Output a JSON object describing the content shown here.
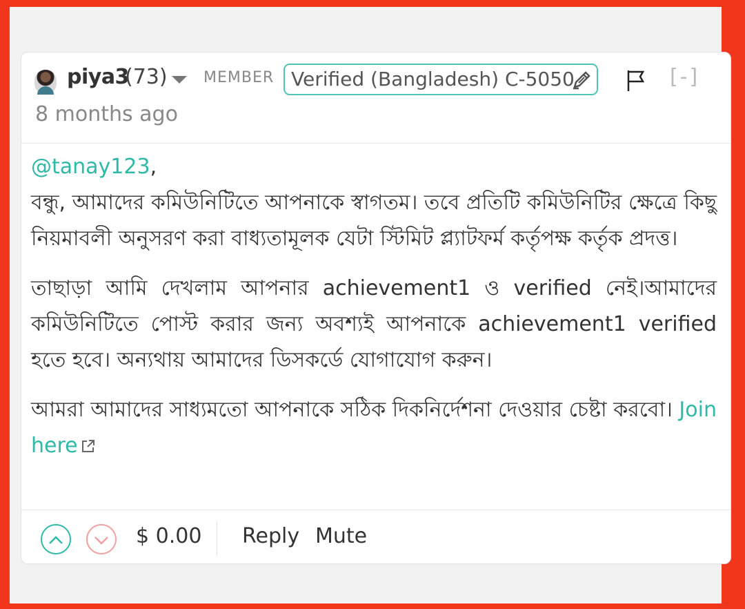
{
  "comment": {
    "author": "piya3",
    "reputation": "(73)",
    "role": "MEMBER",
    "badge": "Verified (Bangladesh) C-5050",
    "timestamp": "8 months ago",
    "collapse_label": "[-]",
    "mention": "@tanay123",
    "paragraphs": [
      "বন্ধু, আমাদের কমিউনিটিতে আপনাকে স্বাগতম। তবে প্রতিটি কমিউনিটির ক্ষেত্রে কিছু নিয়মাবলী অনুসরণ করা বাধ্যতামূলক যেটা স্টিমিট প্ল্যাটফর্ম কর্তৃপক্ষ কর্তৃক প্রদত্ত।",
      "তাছাড়া আমি দেখলাম আপনার achievement1 ও verified নেই।আমাদের কমিউনিটিতে পোস্ট করার জন্য অবশ্যই আপনাকে achievement1 verified হতে হবে। অন্যথায় আমাদের ডিসকর্ডে যোগাযোগ করুন।",
      "আমরা আমাদের সাধ্যমতো আপনাকে সঠিক দিকনির্দেশনা দেওয়ার চেষ্টা করবো।"
    ],
    "link_text": "Join here",
    "payout": "$ 0.00",
    "reply_label": "Reply",
    "mute_label": "Mute"
  },
  "icons": {
    "upvote": "chevron-up-icon",
    "downvote": "chevron-down-icon",
    "flag": "flag-icon",
    "edit": "pen-icon",
    "external": "external-link-icon"
  },
  "colors": {
    "accent": "#2fb9a6",
    "frame": "#f2361c",
    "downvote": "#f2a0a0"
  }
}
